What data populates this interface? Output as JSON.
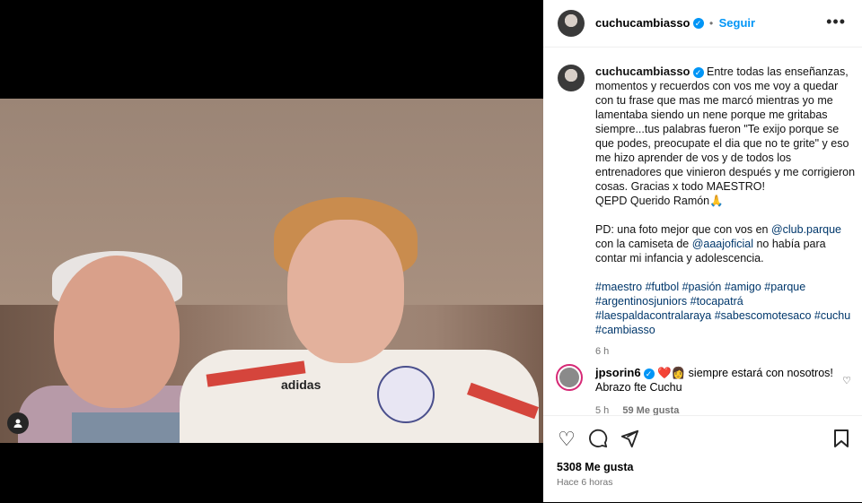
{
  "post": {
    "username": "cuchucambiasso",
    "follow_label": "Seguir",
    "more_icon": "more-horizontal-icon",
    "caption_paragraphs": [
      "Entre todas las enseñanzas, momentos y recuerdos con vos me voy a quedar con tu frase que mas me marcó mientras yo me lamentaba siendo un nene porque me gritabas siempre...tus palabras fueron \"Te exijo porque se que podes, preocupate el dia que no te grite\" y eso me hizo aprender de vos y de todos los entrenadores que vinieron después y me corrigieron cosas. Gracias x todo MAESTRO!\nQEPD Querido Ramón🙏"
    ],
    "ps_prefix": "PD: una foto mejor que con vos en ",
    "ps_mention1": "@club.parque",
    "ps_mid": " con la camiseta de ",
    "ps_mention2": "@aaajoficial",
    "ps_suffix": " no había para contar mi infancia y adolescencia.",
    "hashtags": "#maestro #futbol #pasión #amigo #parque #argentinosjuniors #tocapatrá #laespaldacontralaraya #sabescomotesaco #cuchu #cambiasso",
    "caption_age": "6 h",
    "photo_brand": "adidas"
  },
  "comment": {
    "username": "jpsorin6",
    "emojis": "❤️👩",
    "text": " siempre estará con nosotros! Abrazo fte Cuchu",
    "age": "5 h",
    "likes": "59 Me gusta"
  },
  "actions": {
    "like_icon": "heart-icon",
    "comment_icon": "comment-icon",
    "share_icon": "send-icon",
    "save_icon": "bookmark-icon",
    "likes_count": "5308 Me gusta",
    "posted": "Hace 6 horas"
  }
}
